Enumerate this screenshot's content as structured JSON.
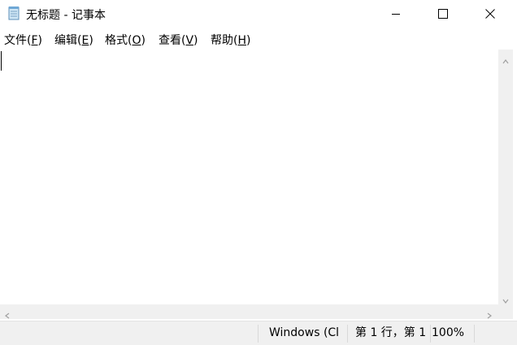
{
  "window": {
    "title": "无标题 - 记事本",
    "controls": {
      "minimize_icon": "minimize-icon",
      "maximize_icon": "maximize-icon",
      "close_icon": "close-icon"
    }
  },
  "menu": {
    "items": [
      {
        "label": "文件",
        "accel": "(",
        "key": "F",
        "close": ")"
      },
      {
        "label": "编辑",
        "accel": "(",
        "key": "E",
        "close": ")"
      },
      {
        "label": "格式",
        "accel": "(",
        "key": "O",
        "close": ")"
      },
      {
        "label": "查看",
        "accel": "(",
        "key": "V",
        "close": ")"
      },
      {
        "label": "帮助",
        "accel": "(",
        "key": "H",
        "close": ")"
      }
    ]
  },
  "editor": {
    "content": ""
  },
  "statusbar": {
    "encoding_line_ending": "Windows (Cl",
    "cursor_position": "第 1 行，第 1",
    "zoom": "100%"
  },
  "colors": {
    "background": "#ffffff",
    "chrome": "#f0f0f0",
    "text": "#000000"
  }
}
